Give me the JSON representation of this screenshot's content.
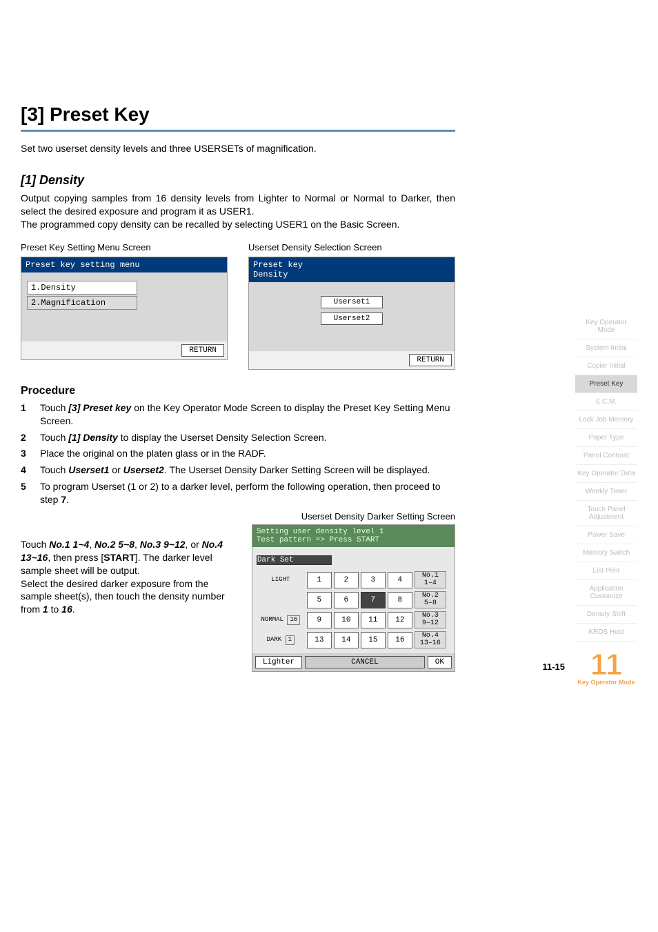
{
  "heading": "[3] Preset Key",
  "intro": "Set two userset density levels and three USERSETs of magnification.",
  "sub_heading": "[1] Density",
  "density_p1": "Output copying samples from 16 density levels from Lighter to Normal or Normal to Darker, then select the desired exposure and program it as USER1.",
  "density_p2": "The programmed copy density can be recalled by selecting USER1 on the Basic Screen.",
  "screen1_caption": "Preset Key Setting Menu Screen",
  "screen2_caption": "Userset Density Selection Screen",
  "lcd1": {
    "title": "Preset key setting menu",
    "item1": "1.Density",
    "item2": "2.Magnification",
    "return": "RETURN"
  },
  "lcd2": {
    "title": "Preset key\nDensity",
    "btn1": "Userset1",
    "btn2": "Userset2",
    "return": "RETURN"
  },
  "procedure_heading": "Procedure",
  "steps": {
    "s1": {
      "n": "1",
      "pre": "Touch ",
      "b": "[3] Preset key",
      "post": " on the Key Operator Mode Screen to display the Preset Key Setting Menu Screen."
    },
    "s2": {
      "n": "2",
      "pre": "Touch ",
      "b": "[1] Density",
      "post": " to display the Userset Density Selection Screen."
    },
    "s3": {
      "n": "3",
      "text": "Place the original on the platen glass or in the RADF."
    },
    "s4": {
      "n": "4",
      "pre": "Touch ",
      "b1": "Userset1",
      "mid": " or ",
      "b2": "Userset2",
      "post": ". The Userset Density Darker Setting Screen will be displayed."
    },
    "s5": {
      "n": "5",
      "pre": "To program Userset (1 or 2) to a darker level, perform the following operation, then proceed to step ",
      "b": "7",
      "post": "."
    }
  },
  "screen3_caption": "Userset Density Darker Setting Screen",
  "instr": {
    "line1_pre": "Touch ",
    "b1": "No.1 1~4",
    "c1": ", ",
    "b2": "No.2 5~8",
    "c2": ", ",
    "b3": "No.3 9~12",
    "c3": ", or ",
    "b4": "No.4 13~16",
    "c4": ", then press [",
    "b5": "START",
    "c5": "]. The darker level sample sheet will be output.",
    "line2_pre": "Select the desired darker exposure from the sample sheet(s), then touch the density number from ",
    "bn1": "1",
    "mid": " to ",
    "bn2": "16",
    "post": "."
  },
  "lcd3": {
    "head1": "Setting user density level 1",
    "head2": "Test pattern => Press START",
    "darkset": "Dark Set",
    "cells": [
      "1",
      "2",
      "3",
      "4",
      "5",
      "6",
      "7",
      "8",
      "9",
      "10",
      "11",
      "12",
      "13",
      "14",
      "15",
      "16"
    ],
    "groups": [
      "No.1\n1–4",
      "No.2\n5–8",
      "No.3\n9–12",
      "No.4\n13–16"
    ],
    "side": {
      "light": "LIGHT",
      "normal": "NORMAL",
      "normal_num": "16",
      "dark": "DARK",
      "dark_num": "1"
    },
    "lighter": "Lighter",
    "cancel": "CANCEL",
    "ok": "OK"
  },
  "sidebar": {
    "items": [
      "Key Operator Mode",
      "System Initial",
      "Copier Initial",
      "Preset Key",
      "E.C.M.",
      "Lock Job Memory",
      "Paper Type",
      "Panel Contrast",
      "Key Operator Data",
      "Weekly Timer",
      "Touch Panel Adjustment",
      "Power Save",
      "Memory Switch",
      "List Print",
      "Application Customize",
      "Density Shift",
      "KRDS Host"
    ],
    "active_index": 3
  },
  "page_number": "11-15",
  "chapter": {
    "num": "11",
    "label": "Key Operator Mode"
  }
}
